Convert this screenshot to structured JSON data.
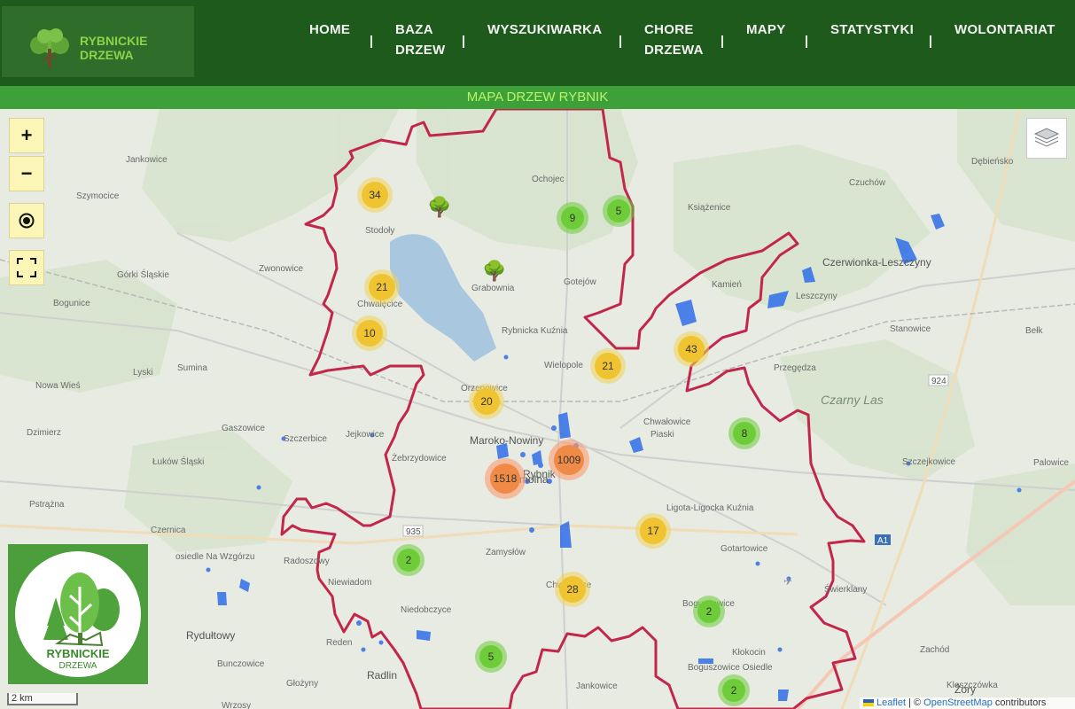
{
  "header": {
    "logo_line1": "RYBNICKIE",
    "logo_line2": "DRZEWA",
    "nav": [
      {
        "line1": "HOME",
        "line2": ""
      },
      {
        "line1": "BAZA",
        "line2": "DRZEW"
      },
      {
        "line1": "WYSZUKIWARKA",
        "line2": ""
      },
      {
        "line1": "CHORE",
        "line2": "DRZEWA"
      },
      {
        "line1": "MAPY",
        "line2": ""
      },
      {
        "line1": "STATYSTYKI",
        "line2": ""
      },
      {
        "line1": "WOLONTARIAT",
        "line2": ""
      }
    ]
  },
  "banner": {
    "title": "MAPA DRZEW RYBNIK"
  },
  "map_controls": {
    "zoom_in": "+",
    "zoom_out": "−"
  },
  "clusters": [
    {
      "count": "34",
      "color": "yellow"
    },
    {
      "count": "9",
      "color": "green"
    },
    {
      "count": "5",
      "color": "green"
    },
    {
      "count": "21",
      "color": "yellow"
    },
    {
      "count": "10",
      "color": "yellow"
    },
    {
      "count": "21",
      "color": "yellow"
    },
    {
      "count": "43",
      "color": "yellow"
    },
    {
      "count": "20",
      "color": "yellow"
    },
    {
      "count": "8",
      "color": "green"
    },
    {
      "count": "1009",
      "color": "orange"
    },
    {
      "count": "1518",
      "color": "orange"
    },
    {
      "count": "17",
      "color": "yellow"
    },
    {
      "count": "2",
      "color": "green"
    },
    {
      "count": "28",
      "color": "yellow"
    },
    {
      "count": "2",
      "color": "green"
    },
    {
      "count": "5",
      "color": "green"
    },
    {
      "count": "2",
      "color": "green"
    }
  ],
  "places": [
    "Jankowice",
    "Szymocice",
    "Stodoły",
    "Ochojec",
    "Książenice",
    "Dębieńsko",
    "Czuchów",
    "Zwonowice",
    "Górki Śląskie",
    "Bogunice",
    "Chwałęcice",
    "Grabownia",
    "Gotejów",
    "Kamień",
    "Czerwionka-Leszczyny",
    "Leszczyny",
    "Rybnicka Kuźnia",
    "Wielopole",
    "Przegędza",
    "Stanowice",
    "Bełk",
    "Sumina",
    "Lyski",
    "Nowa Wieś",
    "Orzepowice",
    "Dzimierz",
    "Gaszowice",
    "Szczerbice",
    "Jejkowice",
    "Maroko-Nowiny",
    "Chwałowice",
    "Piaski",
    "Czarny Las",
    "Łuków Śląski",
    "Żebrzydowice",
    "Rybnik",
    "Szczejkowice",
    "Palowice",
    "Pstrążna",
    "Smolna",
    "Ligota-Ligocka Kuźnia",
    "Czernica",
    "Radoszowy",
    "Zamysłów",
    "Gotartowice",
    "osiedle Na Wzgórzu",
    "Niewiadom",
    "Chwałęcice",
    "Świerklany",
    "Niedobczyce",
    "Boguszowice",
    "Rydułtowy",
    "Reden",
    "Kłokocin",
    "Zachód",
    "Bunczowice",
    "Radlin",
    "Jankowice",
    "Boguszowice Osiedle",
    "Kleszczówka",
    "Głożyny",
    "Żory",
    "Wrzosy",
    "Ochojec"
  ],
  "brand_logo": {
    "line1": "RYBNICKIE",
    "line2": "DRZEWA"
  },
  "scale": "2 km",
  "attribution": {
    "leaflet": "Leaflet",
    "sep": " | © ",
    "osm": "OpenStreetMap",
    "rest": " contributors"
  },
  "road_labels": [
    "935",
    "924",
    "A1"
  ],
  "colors": {
    "header": "#1f5a1d",
    "banner": "#3ea038",
    "banner_text": "#b7f56b",
    "boundary": "#c2274b",
    "tree_blue": "#2f6ee8"
  }
}
